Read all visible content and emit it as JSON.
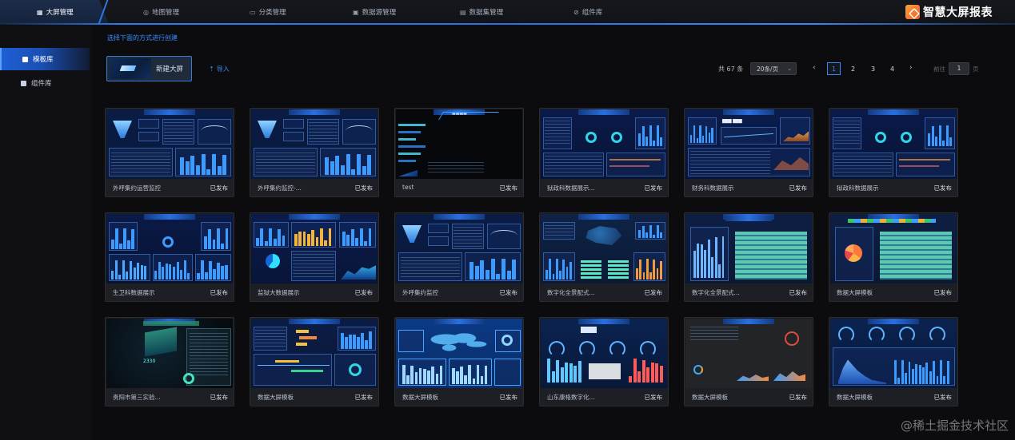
{
  "nav": {
    "items": [
      {
        "label": "大屏管理",
        "icon": "grid-icon"
      },
      {
        "label": "地图管理",
        "icon": "map-pin-icon"
      },
      {
        "label": "分类管理",
        "icon": "folder-icon"
      },
      {
        "label": "数据源管理",
        "icon": "database-icon"
      },
      {
        "label": "数据集管理",
        "icon": "dataset-icon"
      },
      {
        "label": "组件库",
        "icon": "component-icon"
      }
    ],
    "brand": "智慧大屏报表"
  },
  "sidebar": {
    "items": [
      {
        "label": "模板库"
      },
      {
        "label": "组件库"
      }
    ]
  },
  "main": {
    "hint": "选择下面的方式进行创建",
    "new_button": "新建大屏",
    "import_label": "导入",
    "pagination": {
      "total": "共 67 条",
      "page_size": "20条/页",
      "pages": [
        "1",
        "2",
        "3",
        "4"
      ],
      "current": "1",
      "goto_label": "前往",
      "goto_value": "1",
      "goto_unit": "页"
    }
  },
  "cards": [
    {
      "name": "外呼集约运营监控",
      "status": "已发布"
    },
    {
      "name": "外呼集约监控-...",
      "status": "已发布"
    },
    {
      "name": "test",
      "status": "已发布"
    },
    {
      "name": "狱政科数据展示...",
      "status": "已发布"
    },
    {
      "name": "财务科数据展示",
      "status": "已发布"
    },
    {
      "name": "狱政科数据展示",
      "status": "已发布"
    },
    {
      "name": "生卫科数据展示",
      "status": "已发布"
    },
    {
      "name": "监狱大数据展示",
      "status": "已发布"
    },
    {
      "name": "外呼集约监控",
      "status": "已发布"
    },
    {
      "name": "数字化全景配式...",
      "status": "已发布"
    },
    {
      "name": "数字化全景配式...",
      "status": "已发布"
    },
    {
      "name": "数据大屏模板",
      "status": "已发布"
    },
    {
      "name": "贵阳市第三实验...",
      "status": "已发布"
    },
    {
      "name": "数据大屏模板",
      "status": "已发布"
    },
    {
      "name": "数据大屏模板",
      "status": "已发布"
    },
    {
      "name": "山东康格数字化...",
      "status": "已发布"
    },
    {
      "name": "数据大屏模板",
      "status": "已发布"
    },
    {
      "name": "数据大屏模板",
      "status": "已发布"
    }
  ],
  "watermark": "@稀土掘金技术社区",
  "colors": {
    "accent": "#3c8dff",
    "active_nav": "#1e5fd6",
    "brand": "#ef5d2a"
  }
}
